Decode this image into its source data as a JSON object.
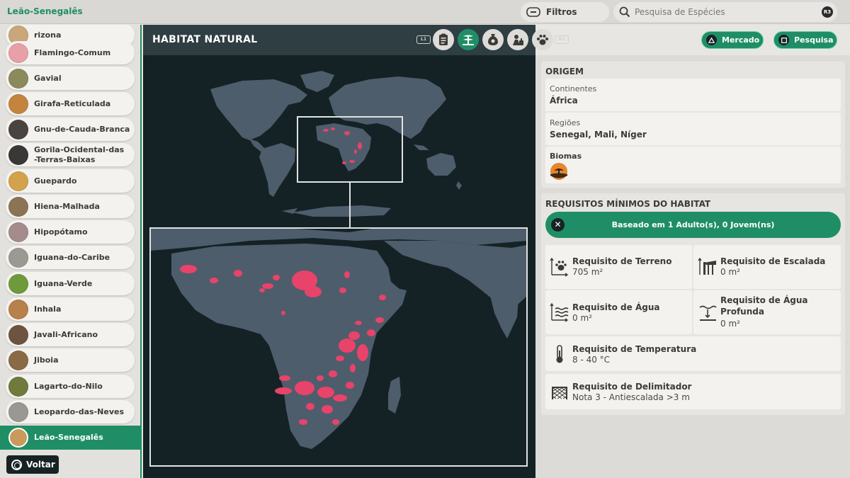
{
  "top_bar": {
    "title": "Leão-Senegalês",
    "filters_label": "Filtros",
    "search_placeholder": "Pesquisa de Espécies",
    "search_shortcut": "R3"
  },
  "sidebar": {
    "items": [
      {
        "label": "rizona",
        "color": "#c9a77a"
      },
      {
        "label": "Flamingo-Comum",
        "color": "#e8a0a8"
      },
      {
        "label": "Gavial",
        "color": "#8a8a5c"
      },
      {
        "label": "Girafa-Reticulada",
        "color": "#c2843f"
      },
      {
        "label": "Gnu-de-Cauda-Branca",
        "color": "#4a4440"
      },
      {
        "label": "Gorila-Ocidental-das-Terras-Baixas",
        "color": "#3a3836"
      },
      {
        "label": "Guepardo",
        "color": "#d4a24c"
      },
      {
        "label": "Hiena-Malhada",
        "color": "#8d7356"
      },
      {
        "label": "Hipopótamo",
        "color": "#a58c8c"
      },
      {
        "label": "Iguana-do-Caribe",
        "color": "#9a9a92"
      },
      {
        "label": "Iguana-Verde",
        "color": "#6f9a3c"
      },
      {
        "label": "Inhala",
        "color": "#b8804a"
      },
      {
        "label": "Javali-Africano",
        "color": "#6e5440"
      },
      {
        "label": "Jiboia",
        "color": "#8a6a44"
      },
      {
        "label": "Lagarto-do-Nilo",
        "color": "#6f7a3c"
      },
      {
        "label": "Leopardo-das-Neves",
        "color": "#9a9892"
      },
      {
        "label": "Leão-Senegalês",
        "color": "#c99a5a",
        "selected": true
      }
    ],
    "back_label": "Voltar"
  },
  "map_panel": {
    "title": "HABITAT NATURAL",
    "left_shoulder": "L1",
    "right_shoulder": "R1",
    "tabs": [
      {
        "icon": "clipboard-icon",
        "active": false
      },
      {
        "icon": "habitat-icon",
        "active": true
      },
      {
        "icon": "food-sack-icon",
        "active": false
      },
      {
        "icon": "enrichment-icon",
        "active": false
      },
      {
        "icon": "paw-icon",
        "active": false
      }
    ],
    "market_label": "Mercado",
    "research_label": "Pesquisa",
    "habitat_color": "#e8436a",
    "land_color": "#4e5d6b"
  },
  "origin": {
    "title": "ORIGEM",
    "continents_label": "Continentes",
    "continents_value": "África",
    "regions_label": "Regiões",
    "regions_value": "Senegal, Mali, Níger",
    "biomes_label": "Biomas",
    "biome_icon": "savanna-biome-icon"
  },
  "requirements": {
    "title": "REQUISITOS MÍNIMOS DO HABITAT",
    "based_on": "Baseado em 1 Adulto(s), 0 Jovem(ns)",
    "items": [
      {
        "title": "Requisito de Terreno",
        "value": "705 m²",
        "icon": "terrain-icon"
      },
      {
        "title": "Requisito de Escalada",
        "value": "0 m²",
        "icon": "climbing-icon"
      },
      {
        "title": "Requisito de Água",
        "value": "0 m²",
        "icon": "water-icon"
      },
      {
        "title": "Requisito de Água Profunda",
        "value": "0 m²",
        "icon": "deep-water-icon"
      },
      {
        "title": "Requisito de Temperatura",
        "value": "8 - 40 °C",
        "icon": "thermometer-icon"
      },
      {
        "title": "Requisito de Delimitador",
        "value": "Nota 3 - Antiescalada >3 m",
        "icon": "fence-icon"
      }
    ]
  }
}
